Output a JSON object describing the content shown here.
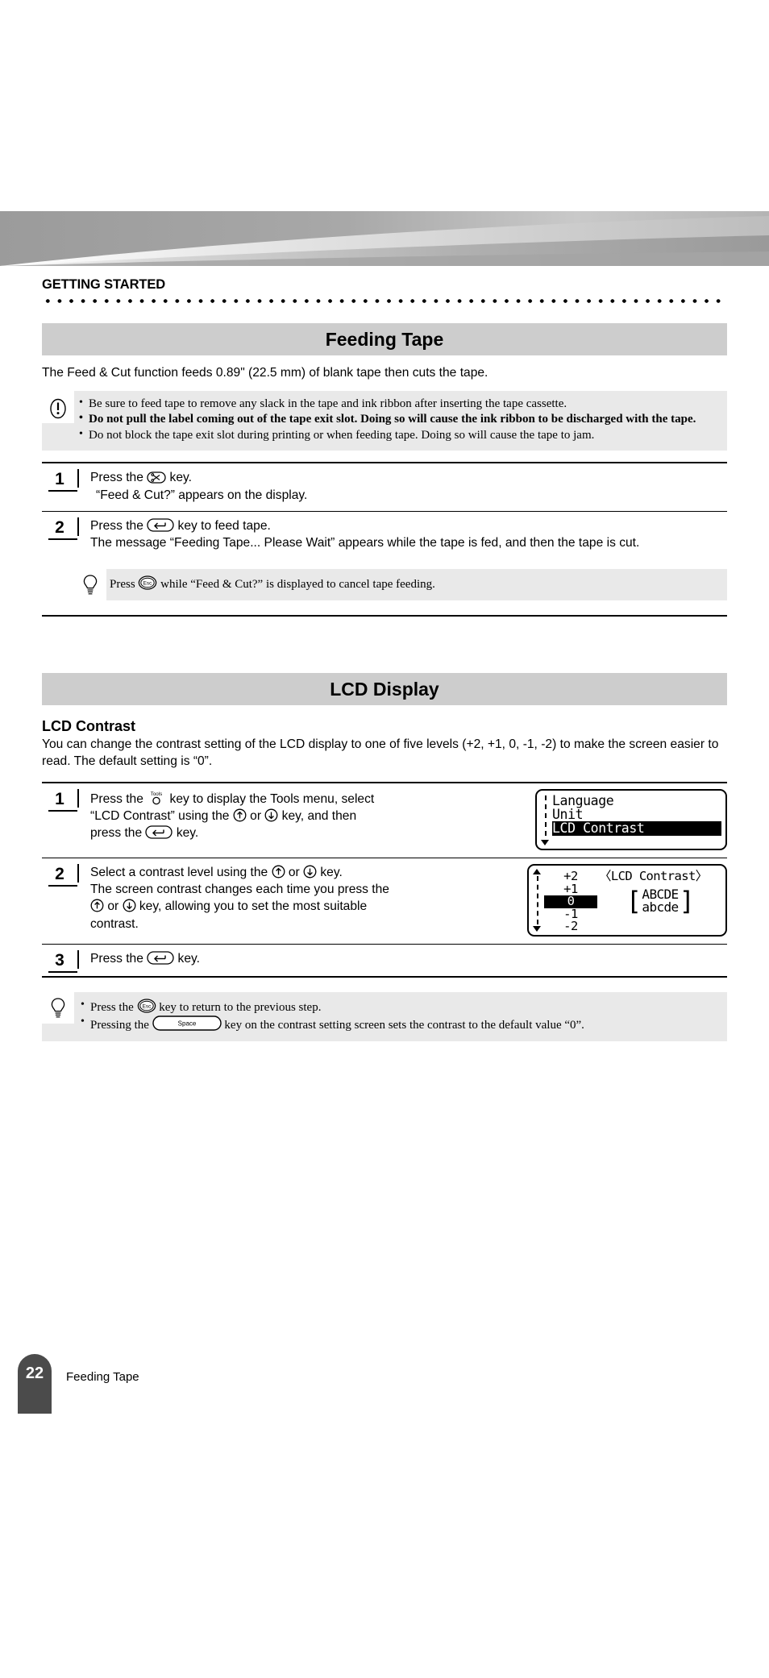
{
  "running_head": "GETTING STARTED",
  "sections": [
    {
      "title": "Feeding Tape",
      "intro": "The Feed & Cut function feeds 0.89\" (22.5 mm) of blank tape then cuts the tape.",
      "note": {
        "icon": "caution-icon",
        "items": [
          {
            "bold": false,
            "text": "Be sure to feed tape to remove any slack in the tape and ink ribbon after inserting the tape cassette."
          },
          {
            "bold": true,
            "text": "Do not pull the label coming out of the tape exit slot. Doing so will cause the ink ribbon to be discharged with the tape."
          },
          {
            "bold": false,
            "text": "Do not block the tape exit slot during printing or when feeding tape. Doing so will cause the tape to jam."
          }
        ]
      },
      "steps": [
        {
          "number": "1",
          "lines": [
            {
              "pre": "Press the ",
              "key": "feed-cut-key",
              "post": " key."
            },
            {
              "pre": "“Feed & Cut?” appears on the display.",
              "key": null,
              "post": "",
              "indent": true
            }
          ]
        },
        {
          "number": "2",
          "lines": [
            {
              "pre": "Press the ",
              "key": "enter-key",
              "post": " key to feed tape."
            },
            {
              "pre": "The message “Feeding Tape... Please Wait” appears while the tape is fed, and then the tape is cut.",
              "key": null,
              "post": ""
            }
          ]
        }
      ],
      "tip": {
        "icon": "lightbulb-icon",
        "items": [
          {
            "pre": "Press ",
            "key": "esc-key",
            "post": " while “Feed & Cut?” is displayed to cancel tape feeding."
          }
        ]
      }
    },
    {
      "title": "LCD Display",
      "subhead": "LCD Contrast",
      "intro": "You can change the contrast setting of the LCD display to one of five levels (+2, +1, 0, -1, -2) to make the screen easier to read. The default setting is “0”.",
      "steps": [
        {
          "number": "1",
          "line1_pre": "Press the ",
          "line1_key": "tools-key",
          "line1_post": " key to display the Tools menu, select",
          "line2_pre": "“LCD Contrast” using the ",
          "line2_key_a": "up-key",
          "line2_mid": " or ",
          "line2_key_b": "down-key",
          "line2_post": " key, and then",
          "line3_pre": "press the ",
          "line3_key": "enter-key",
          "line3_post": " key."
        },
        {
          "number": "2",
          "line1_pre": "Select a contrast level using the ",
          "line1_key_a": "up-key",
          "line1_mid": " or ",
          "line1_key_b": "down-key",
          "line1_post": " key.",
          "line2": "The screen contrast changes each time you press the",
          "line3_key_a": "up-key",
          "line3_mid": " or ",
          "line3_key_b": "down-key",
          "line3_post": " key, allowing you to set the most suitable",
          "line4": "contrast."
        },
        {
          "number": "3",
          "line1_pre": "Press the ",
          "line1_key": "enter-key",
          "line1_post": " key."
        }
      ],
      "tip": {
        "icon": "lightbulb-icon",
        "items": [
          {
            "pre": "Press the ",
            "key": "esc-key",
            "post": " key to return to the previous step."
          },
          {
            "pre": "Pressing the ",
            "key": "space-key",
            "post": " key on the contrast setting screen sets the contrast to the default value “0”."
          }
        ]
      }
    }
  ],
  "lcd_menu": {
    "items": [
      "Language",
      "Unit",
      "LCD Contrast"
    ],
    "selected_index": 2,
    "scroll_arrow": "down"
  },
  "lcd_contrast": {
    "title": "〈LCD Contrast〉",
    "levels": [
      "+2",
      "+1",
      " 0 ",
      "-1",
      "-2"
    ],
    "selected_index": 2,
    "sample_upper": "ABCDE",
    "sample_lower": "abcde",
    "scroll_arrows": "up-down"
  },
  "keys": {
    "feed-cut-key": "✂",
    "enter-key": "↵",
    "esc-key": "Esc",
    "tools-key": "Tools",
    "up-key": "↑",
    "down-key": "↓",
    "space-key": "Space"
  },
  "footer": {
    "page_number": "22",
    "label": "Feeding Tape"
  },
  "colors": {
    "section_bar": "#cdcdcd",
    "note_bg": "#e9e9e9",
    "page_tab": "#4b4b4b",
    "banner_dark": "#9a9a9a",
    "banner_light": "#ededed"
  }
}
